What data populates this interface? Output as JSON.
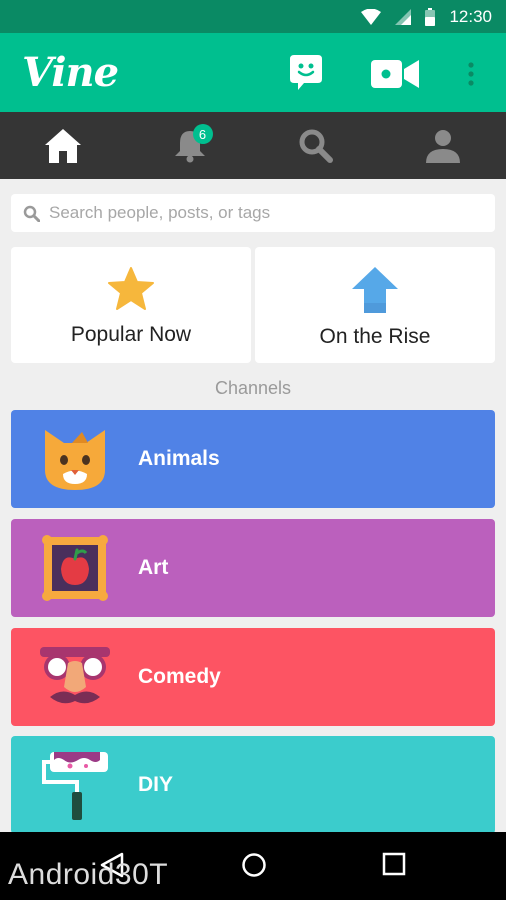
{
  "status_bar": {
    "time": "12:30"
  },
  "app_bar": {
    "logo": "Vine",
    "icons": [
      "messages-icon",
      "video-camera-icon",
      "more-vert-icon"
    ]
  },
  "tabs": [
    {
      "icon": "home-icon",
      "active": true
    },
    {
      "icon": "notifications-icon",
      "badge": "6"
    },
    {
      "icon": "search-icon"
    },
    {
      "icon": "profile-icon"
    }
  ],
  "search": {
    "placeholder": "Search people, posts, or tags",
    "value": ""
  },
  "featured": [
    {
      "label": "Popular Now",
      "icon": "star-icon"
    },
    {
      "label": "On the Rise",
      "icon": "arrow-up-icon"
    }
  ],
  "channels_title": "Channels",
  "channels": [
    {
      "label": "Animals",
      "icon": "cat-icon",
      "color": "#5082e6"
    },
    {
      "label": "Art",
      "icon": "framed-apple-icon",
      "color": "#bb60bd"
    },
    {
      "label": "Comedy",
      "icon": "disguise-glasses-icon",
      "color": "#fd5463"
    },
    {
      "label": "DIY",
      "icon": "paint-roller-icon",
      "color": "#3bcccc"
    }
  ],
  "colors": {
    "brand": "#00bf8f",
    "status_bar": "#0a8a64",
    "tab_bar": "#353535"
  },
  "watermark": "Android30T"
}
